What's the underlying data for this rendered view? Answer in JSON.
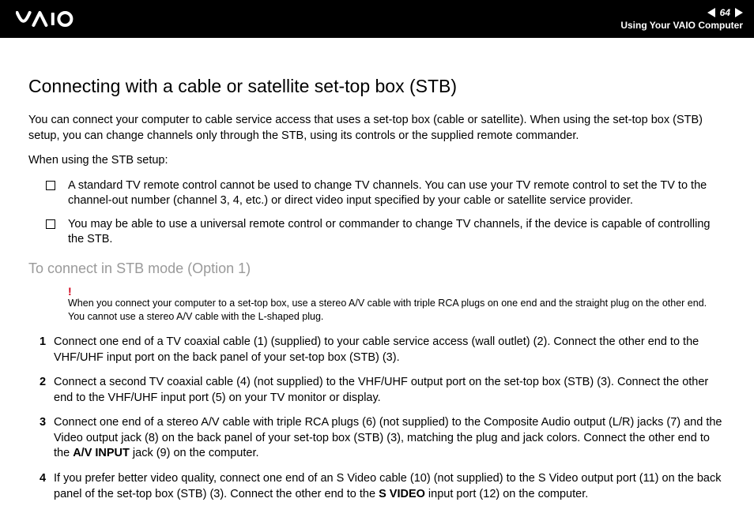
{
  "header": {
    "page_number": "64",
    "section_label": "Using Your VAIO Computer"
  },
  "content": {
    "title": "Connecting with a cable or satellite set-top box (STB)",
    "intro": "You can connect your computer to cable service access that uses a set-top box (cable or satellite). When using the set-top box (STB) setup, you can change channels only through the STB, using its controls or the supplied remote commander.",
    "lead_in": "When using the STB setup:",
    "bullets": [
      "A standard TV remote control cannot be used to change TV channels. You can use your TV remote control to set the TV to the channel-out number (channel 3, 4, etc.) or direct video input specified by your cable or satellite service provider.",
      "You may be able to use a universal remote control or commander to change TV channels, if the device is capable of controlling the STB."
    ],
    "subhead": "To connect in STB mode (Option 1)",
    "note_bang": "!",
    "note_text": "When you connect your computer to a set-top box, use a stereo A/V cable with triple RCA plugs on one end and the straight plug on the other end. You cannot use a stereo A/V cable with the L-shaped plug.",
    "steps": [
      {
        "num": "1",
        "text": "Connect one end of a TV coaxial cable (1) (supplied) to your cable service access (wall outlet) (2). Connect the other end to the VHF/UHF input port on the back panel of your set-top box (STB) (3)."
      },
      {
        "num": "2",
        "text": "Connect a second TV coaxial cable (4) (not supplied) to the VHF/UHF output port on the set-top box (STB) (3). Connect the other end to the VHF/UHF input port (5) on your TV monitor or display."
      },
      {
        "num": "3",
        "text_pre": "Connect one end of a stereo A/V cable with triple RCA plugs (6) (not supplied) to the Composite Audio output (L/R) jacks (7) and the Video output jack (8) on the back panel of your set-top box (STB) (3), matching the plug and jack colors. Connect the other end to the ",
        "bold1": "A/V INPUT",
        "text_post": " jack (9) on the computer."
      },
      {
        "num": "4",
        "text_pre": "If you prefer better video quality, connect one end of an S Video cable (10) (not supplied) to the S Video output port (11) on the back panel of the set-top box (STB) (3). Connect the other end to the ",
        "bold1": "S VIDEO",
        "text_post": " input port (12) on the computer."
      }
    ]
  }
}
